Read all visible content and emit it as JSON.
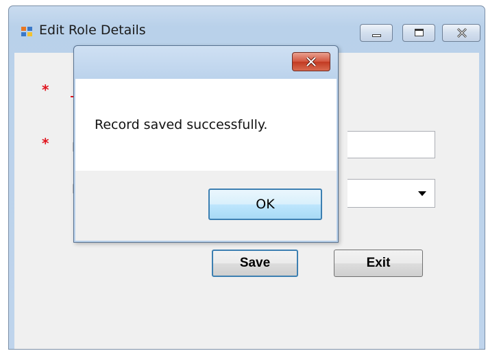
{
  "window": {
    "title": "Edit Role Details",
    "icon": "app-form-icon"
  },
  "form": {
    "required_marker": "*",
    "visible_label_fragment_1": "R",
    "visible_label_fragment_2": "R",
    "save_label": "Save",
    "exit_label": "Exit"
  },
  "dialog": {
    "message": "Record saved successfully.",
    "ok_label": "OK",
    "close_icon": "close-icon"
  },
  "colors": {
    "required_marker": "#e0141e",
    "focus_border": "#3c7fb1",
    "close_button": "#c23a22"
  }
}
